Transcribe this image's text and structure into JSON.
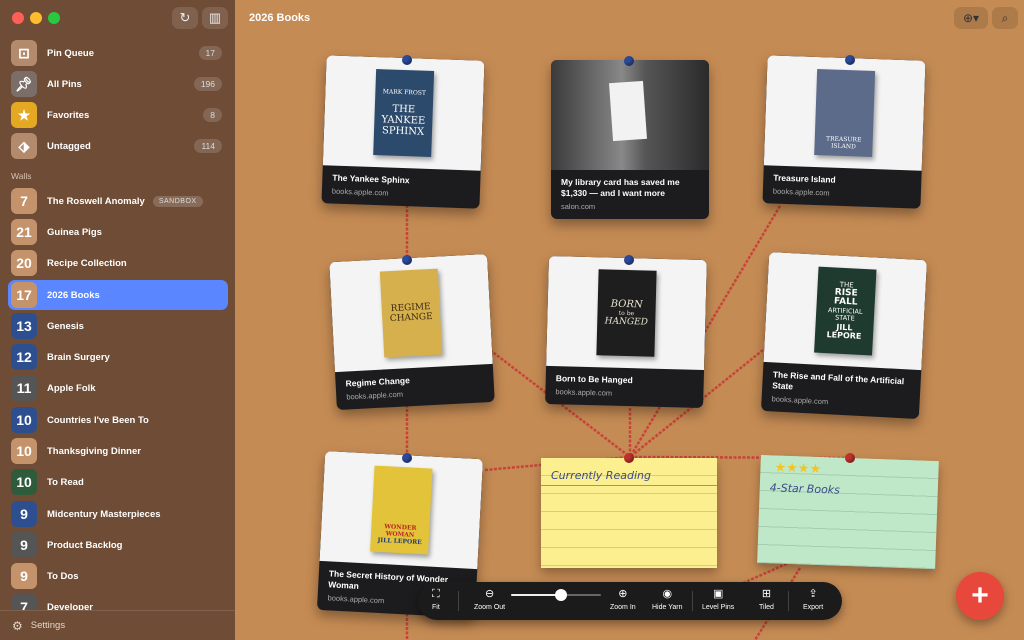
{
  "window": {
    "traffic_colors": [
      "#ff5f57",
      "#febc2e",
      "#28c840"
    ]
  },
  "sidebar": {
    "top_items": [
      {
        "label": "Pin Queue",
        "count": "17",
        "icon": "inbox-icon",
        "color": "#b48a6c"
      },
      {
        "label": "All Pins",
        "count": "196",
        "icon": "pin-icon",
        "color": "#7b6e68"
      },
      {
        "label": "Favorites",
        "count": "8",
        "icon": "star-icon",
        "color": "#e5a823"
      },
      {
        "label": "Untagged",
        "count": "114",
        "icon": "tag-icon",
        "color": "#b48a6c"
      }
    ],
    "walls_heading": "Walls",
    "walls": [
      {
        "num": "7",
        "label": "The Roswell Anomaly",
        "badge": "SANDBOX",
        "color": "#c4936b"
      },
      {
        "num": "21",
        "label": "Guinea Pigs",
        "color": "#c4936b"
      },
      {
        "num": "20",
        "label": "Recipe Collection",
        "color": "#c4936b"
      },
      {
        "num": "17",
        "label": "2026 Books",
        "color": "#c4936b",
        "active": true
      },
      {
        "num": "13",
        "label": "Genesis",
        "color": "#2e4f8f"
      },
      {
        "num": "12",
        "label": "Brain Surgery",
        "color": "#2e4f8f"
      },
      {
        "num": "11",
        "label": "Apple Folk",
        "color": "#555555"
      },
      {
        "num": "10",
        "label": "Countries I've Been To",
        "color": "#2e4f8f"
      },
      {
        "num": "10",
        "label": "Thanksgiving Dinner",
        "color": "#c4936b"
      },
      {
        "num": "10",
        "label": "To Read",
        "color": "#2e5b3a"
      },
      {
        "num": "9",
        "label": "Midcentury Masterpieces",
        "color": "#2e4f8f"
      },
      {
        "num": "9",
        "label": "Product Backlog",
        "color": "#555555"
      },
      {
        "num": "9",
        "label": "To Dos",
        "color": "#c4936b"
      },
      {
        "num": "7",
        "label": "Developer",
        "color": "#555555"
      }
    ],
    "settings_label": "Settings",
    "active_color": "#5a86ff"
  },
  "board": {
    "title": "2026 Books",
    "cards": [
      {
        "title": "The Yankee Sphinx",
        "source": "books.apple.com",
        "book_lines": [
          "MARK FROST",
          "THE",
          "YANKEE",
          "SPHINX"
        ]
      },
      {
        "title": "My library card has saved me $1,330 — and I want more",
        "source": "salon.com"
      },
      {
        "title": "Treasure Island",
        "source": "books.apple.com",
        "book_lines": [
          "TREASURE ISLAND"
        ]
      },
      {
        "title": "Regime Change",
        "source": "books.apple.com",
        "book_lines": [
          "REGIME",
          "CHANGE"
        ]
      },
      {
        "title": "Born to Be Hanged",
        "source": "books.apple.com",
        "book_lines": [
          "BORN",
          "to be",
          "HANGED"
        ]
      },
      {
        "title": "The Rise and Fall of the Artificial State",
        "source": "books.apple.com",
        "book_lines": [
          "THE",
          "RISE",
          "FALL",
          "ARTIFICIAL",
          "STATE",
          "JILL",
          "LEPORE"
        ]
      },
      {
        "title": "The Secret History of Wonder Woman",
        "source": "books.apple.com",
        "book_lines": [
          "WONDER WOMAN",
          "JILL LEPORE"
        ]
      }
    ],
    "notes": [
      {
        "title": "Currently Reading",
        "color": "#fbef8f"
      },
      {
        "title": "4-Star Books",
        "stars": "★★★★",
        "color": "#bfe8c8"
      }
    ]
  },
  "toolbar": {
    "fit": "Fit",
    "zoom_out": "Zoom Out",
    "zoom_in": "Zoom In",
    "hide_yarn": "Hide Yarn",
    "level_pins": "Level Pins",
    "tiled": "Tiled",
    "export": "Export",
    "zoom_level": 0.55
  },
  "fab_label": "+"
}
